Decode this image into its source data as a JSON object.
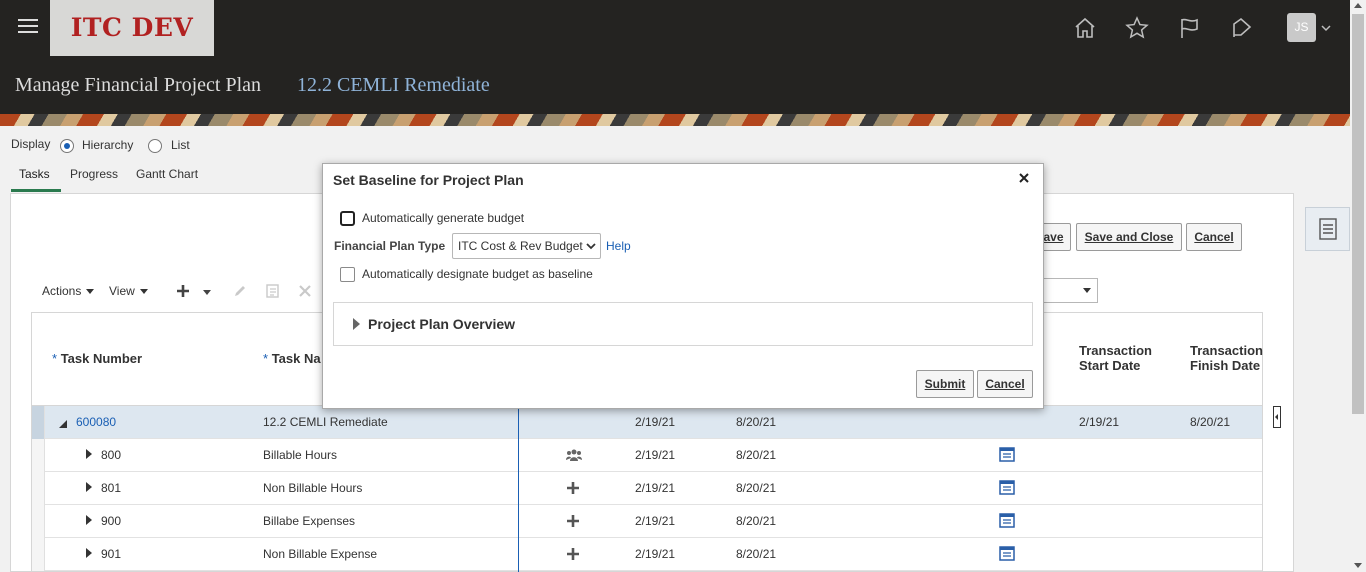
{
  "header": {
    "logo_text": "ITC DEV",
    "user_initials": "JS",
    "icons": [
      "home-icon",
      "star-icon",
      "flag-icon",
      "notification-icon"
    ]
  },
  "page": {
    "title": "Manage Financial Project Plan",
    "project_name": "12.2 CEMLI Remediate"
  },
  "display": {
    "label": "Display",
    "options": [
      "Hierarchy",
      "List"
    ],
    "selected": "Hierarchy"
  },
  "tabs": [
    "Tasks",
    "Progress",
    "Gantt Chart"
  ],
  "active_tab": "Tasks",
  "buttons": {
    "save_partial": "ave",
    "save_and_close": "Save and Close",
    "cancel": "Cancel"
  },
  "toolbar": {
    "actions": "Actions",
    "view": "View"
  },
  "table": {
    "columns": {
      "task_number": "Task Number",
      "task_name": "Task Na",
      "transaction_start": [
        "Transaction",
        "Start Date"
      ],
      "transaction_finish": [
        "Transaction",
        "Finish Date"
      ]
    },
    "rows": [
      {
        "number": "600080",
        "name": "12.2 CEMLI Remediate",
        "start": "2/19/21",
        "finish": "8/20/21",
        "txn_start": "2/19/21",
        "txn_finish": "8/20/21"
      },
      {
        "number": "800",
        "name": "Billable Hours",
        "start": "2/19/21",
        "finish": "8/20/21"
      },
      {
        "number": "801",
        "name": "Non Billable Hours",
        "start": "2/19/21",
        "finish": "8/20/21"
      },
      {
        "number": "900",
        "name": "Billabe Expenses",
        "start": "2/19/21",
        "finish": "8/20/21"
      },
      {
        "number": "901",
        "name": "Non Billable Expense",
        "start": "2/19/21",
        "finish": "8/20/21"
      }
    ]
  },
  "modal": {
    "title": "Set Baseline for Project Plan",
    "auto_generate_label": "Automatically generate budget",
    "fpt_label": "Financial Plan Type",
    "fpt_value": "ITC Cost & Rev Budget",
    "help": "Help",
    "auto_designate_label": "Automatically designate budget as baseline",
    "overview_label": "Project Plan Overview",
    "submit": "Submit",
    "cancel": "Cancel"
  }
}
